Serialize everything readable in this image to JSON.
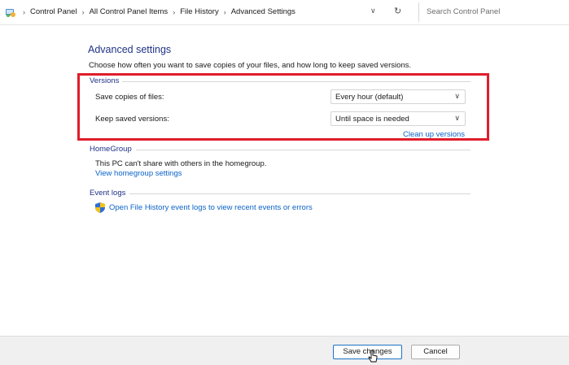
{
  "address_bar": {
    "breadcrumbs": [
      "Control Panel",
      "All Control Panel Items",
      "File History",
      "Advanced Settings"
    ],
    "search_placeholder": "Search Control Panel"
  },
  "page": {
    "title": "Advanced settings",
    "description": "Choose how often you want to save copies of your files, and how long to keep saved versions."
  },
  "versions": {
    "group_label": "Versions",
    "save_copies_label": "Save copies of files:",
    "save_copies_value": "Every hour (default)",
    "keep_versions_label": "Keep saved versions:",
    "keep_versions_value": "Until space is needed",
    "cleanup_link": "Clean up versions"
  },
  "homegroup": {
    "group_label": "HomeGroup",
    "text": "This PC can't share with others in the homegroup.",
    "link": "View homegroup settings"
  },
  "event_logs": {
    "group_label": "Event logs",
    "link": "Open File History event logs to view recent events or errors"
  },
  "footer": {
    "save_label": "Save changes",
    "cancel_label": "Cancel"
  },
  "colors": {
    "heading": "#1e3287",
    "link": "#0b63c8",
    "highlight_box": "#e01d2b"
  },
  "icons": [
    "control-panel-icon",
    "chevron-right-icon",
    "chevron-down-icon",
    "refresh-icon",
    "shield-icon",
    "mouse-cursor-icon"
  ]
}
